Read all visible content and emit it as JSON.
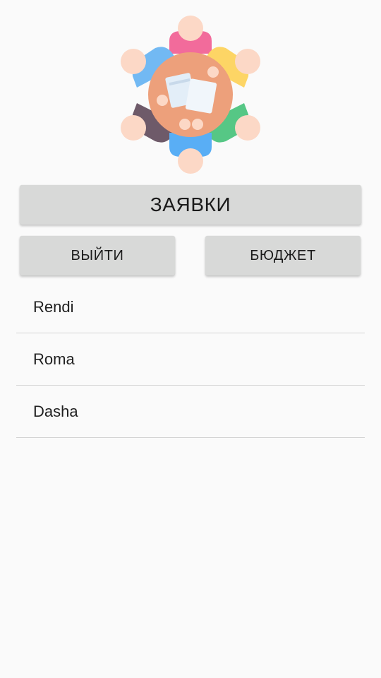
{
  "logo": {
    "icon": "team-meeting-icon"
  },
  "buttons": {
    "requests": "ЗАЯВКИ",
    "logout": "ВЫЙТИ",
    "budget": "БЮДЖЕТ"
  },
  "users": [
    {
      "name": "Rendi"
    },
    {
      "name": "Roma"
    },
    {
      "name": "Dasha"
    }
  ],
  "colors": {
    "background": "#fafafa",
    "button": "#d8d9d8",
    "divider": "#d4d4d4"
  }
}
